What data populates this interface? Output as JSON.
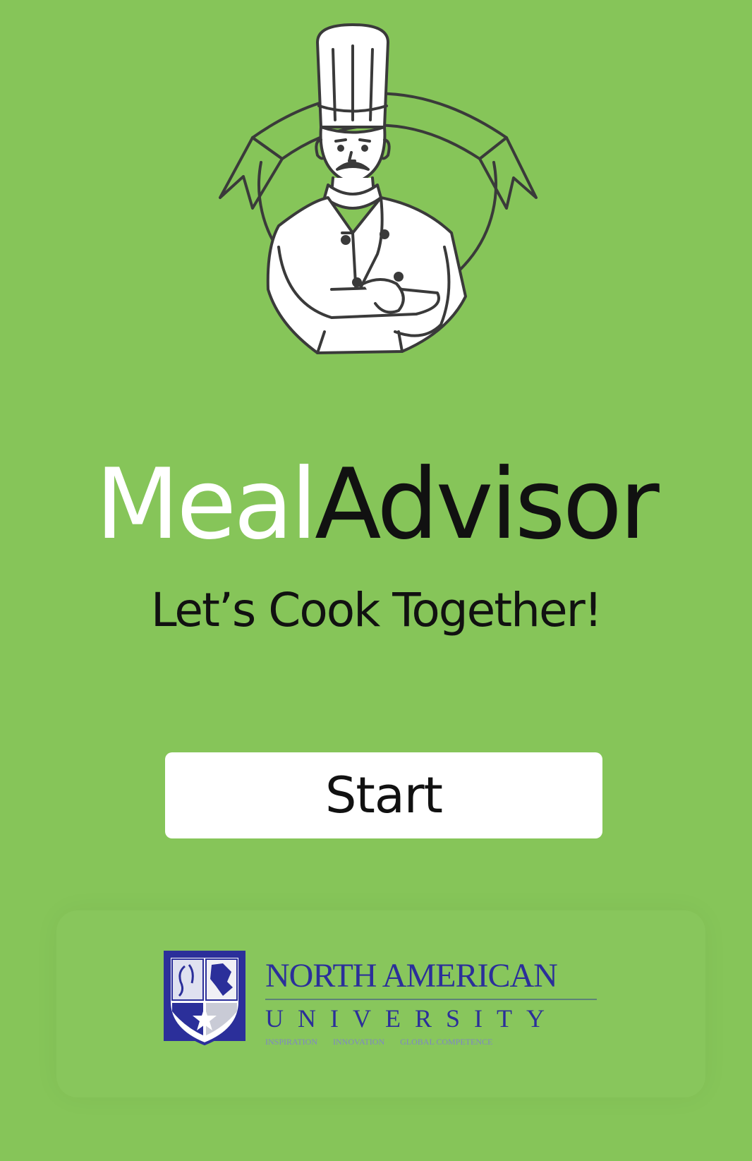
{
  "app": {
    "title_part1": "Meal",
    "title_part2": "Advisor",
    "tagline": "Let’s Cook Together!"
  },
  "actions": {
    "start_label": "Start"
  },
  "university": {
    "name_line1": "NORTH AMERICAN",
    "name_line2": "UNIVERSITY",
    "motto": [
      "INSPIRATION",
      "INNOVATION",
      "GLOBAL COMPETENCE"
    ]
  },
  "colors": {
    "background": "#86c559",
    "button_bg": "#ffffff",
    "university_blue": "#2b2f9a"
  },
  "icons": {
    "chef": "chef-logo-icon",
    "university_shield": "university-shield-icon"
  }
}
